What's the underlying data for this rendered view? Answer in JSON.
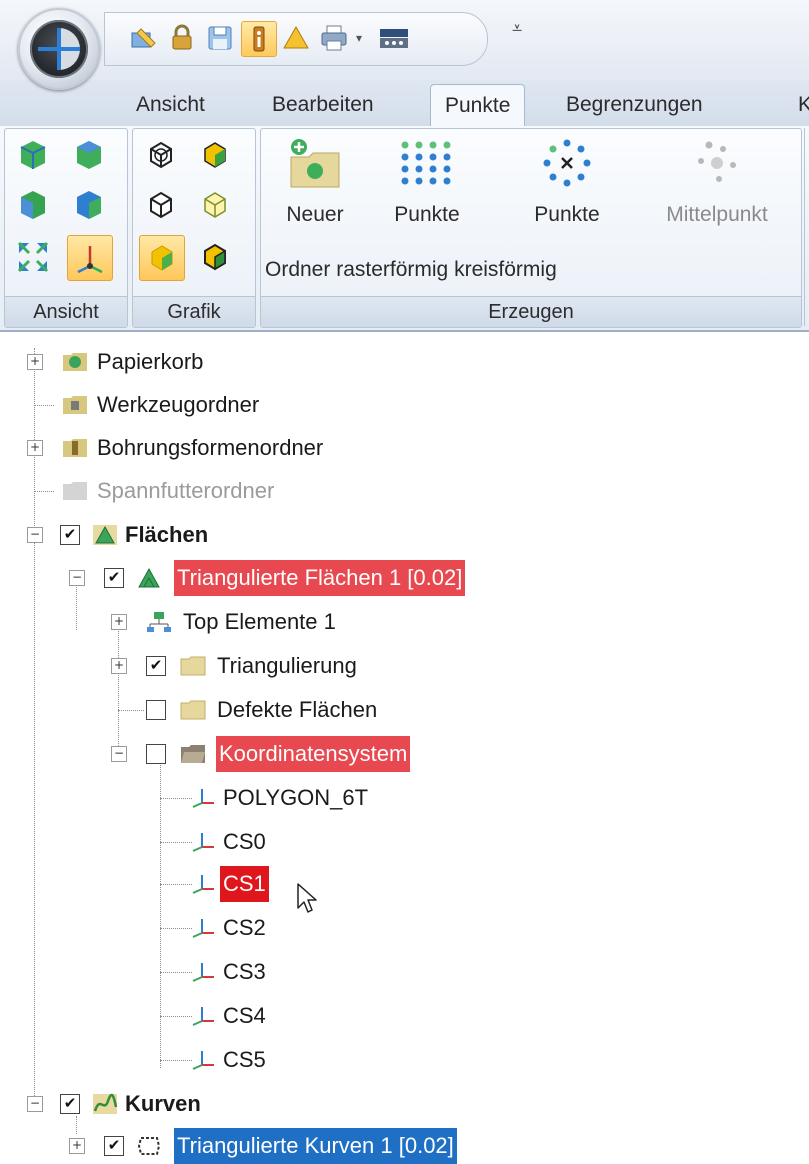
{
  "tabs": [
    {
      "label": "Ansicht"
    },
    {
      "label": "Bearbeiten"
    },
    {
      "label": "Punkte",
      "active": true
    },
    {
      "label": "Begrenzungen"
    },
    {
      "label": "K"
    }
  ],
  "ribbon": {
    "groups": {
      "ansicht": "Ansicht",
      "grafik": "Grafik",
      "erzeugen": "Erzeugen"
    },
    "buttons": {
      "neuer_line1": "Neuer",
      "neuer_line2": "Ordner",
      "raster_line1": "Punkte",
      "raster_line2": "rasterförmig",
      "kreis_line1": "Punkte",
      "kreis_line2": "kreisförmig",
      "mittel_line1": "Mittelpunkt"
    }
  },
  "qat": {
    "overflow_glyph": "⩡"
  },
  "tree": {
    "papierkorb": "Papierkorb",
    "werkzeugordner": "Werkzeugordner",
    "bohrungsformenordner": "Bohrungsformenordner",
    "spannfutterordner": "Spannfutterordner",
    "flaechen": "Flächen",
    "triangulierte_flaechen": "Triangulierte Flächen 1 [0.02]",
    "top_elemente": "Top Elemente 1",
    "triangulierung": "Triangulierung",
    "defekte_flaechen": "Defekte Flächen",
    "koordinatensystem": "Koordinatensystem",
    "polygon": "POLYGON_6T",
    "cs0": "CS0",
    "cs1": "CS1",
    "cs2": "CS2",
    "cs3": "CS3",
    "cs4": "CS4",
    "cs5": "CS5",
    "kurven": "Kurven",
    "triangulierte_kurven": "Triangulierte Kurven 1 [0.02]"
  },
  "symbols": {
    "plus": "+",
    "minus": "−",
    "check": "✔"
  },
  "colors": {
    "selection_red": "#e8484f",
    "selection_red_strong": "#e0161d",
    "selection_blue": "#1f6fc4",
    "tab_bar": "#d3ddea"
  }
}
